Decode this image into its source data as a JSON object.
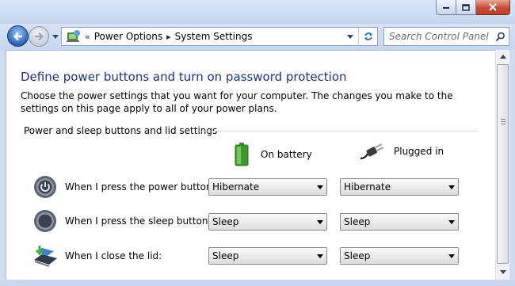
{
  "window": {
    "caption_buttons": [
      "minimize-icon",
      "maximize-icon",
      "close-icon"
    ]
  },
  "nav": {
    "back_icon": "back-arrow-icon",
    "forward_icon": "forward-arrow-icon",
    "breadcrumb_overflow": "«",
    "breadcrumbs": [
      "Power Options",
      "System Settings"
    ],
    "search_placeholder": "Search Control Panel"
  },
  "page": {
    "title": "Define power buttons and turn on password protection",
    "description": "Choose the power settings that you want for your computer. The changes you make to the settings on this page apply to all of your power plans.",
    "group_label": "Power and sleep buttons and lid settings",
    "columns": [
      {
        "label": "On battery",
        "icon": "battery-icon"
      },
      {
        "label": "Plugged in",
        "icon": "power-plug-icon"
      }
    ],
    "rows": [
      {
        "label": "When I press the power button:",
        "icon": "power-button-icon",
        "on_battery": "Hibernate",
        "plugged_in": "Hibernate"
      },
      {
        "label": "When I press the sleep button:",
        "icon": "sleep-button-icon",
        "on_battery": "Sleep",
        "plugged_in": "Sleep"
      },
      {
        "label": "When I close the lid:",
        "icon": "laptop-lid-icon",
        "on_battery": "Sleep",
        "plugged_in": "Sleep"
      }
    ]
  },
  "colors": {
    "title": "#1e3287",
    "chrome": "#c5d6ee",
    "close_button": "#c74b33"
  }
}
